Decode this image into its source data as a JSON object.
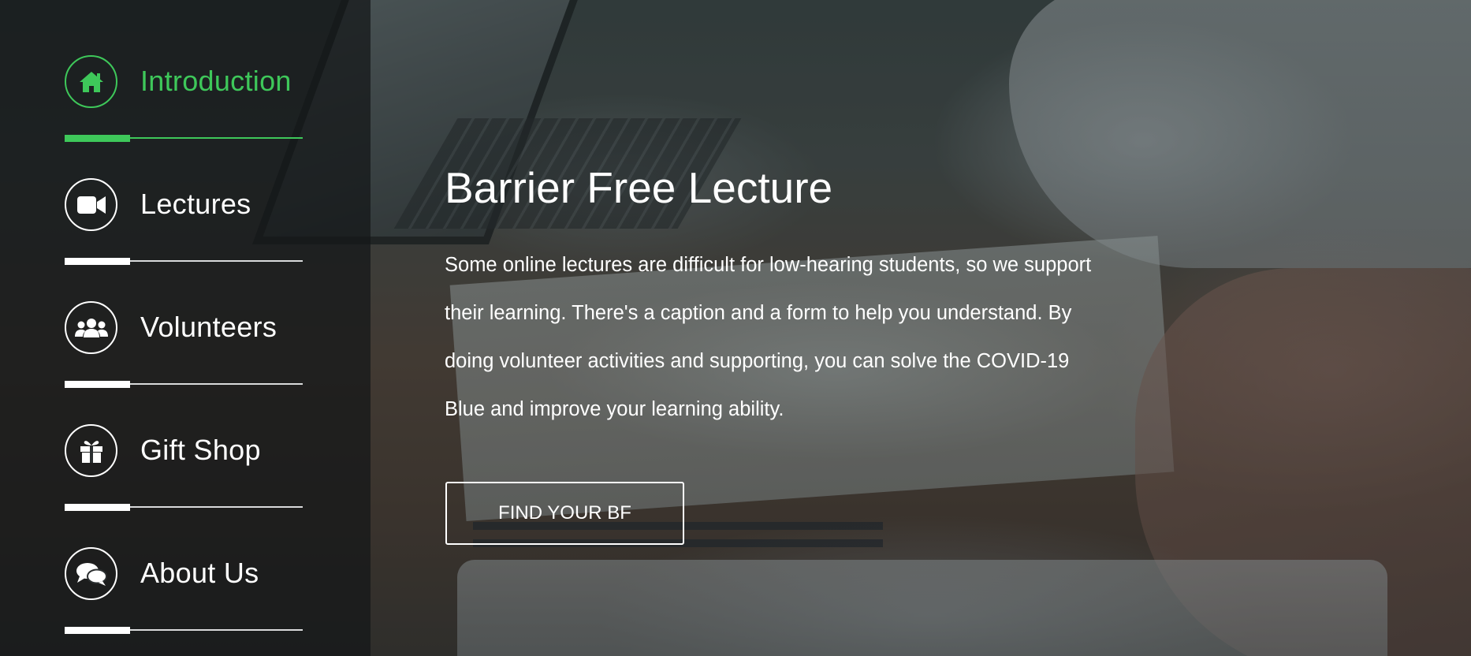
{
  "sidebar": {
    "items": [
      {
        "label": "Introduction",
        "icon": "home-icon",
        "active": true
      },
      {
        "label": "Lectures",
        "icon": "video-camera-icon",
        "active": false
      },
      {
        "label": "Volunteers",
        "icon": "users-icon",
        "active": false
      },
      {
        "label": "Gift Shop",
        "icon": "gift-icon",
        "active": false
      },
      {
        "label": "About Us",
        "icon": "chat-bubbles-icon",
        "active": false
      }
    ]
  },
  "main": {
    "title": "Barrier Free Lecture",
    "description": "Some online lectures are difficult for low-hearing students, so we support their learning. There's a caption and a form to help you understand. By doing volunteer activities and supporting, you can solve the COVID-19 Blue and improve your learning ability.",
    "cta_label": "FIND YOUR BF"
  },
  "colors": {
    "accent": "#3ec85a",
    "text": "#ffffff",
    "sidebar_bg": "#141618"
  }
}
